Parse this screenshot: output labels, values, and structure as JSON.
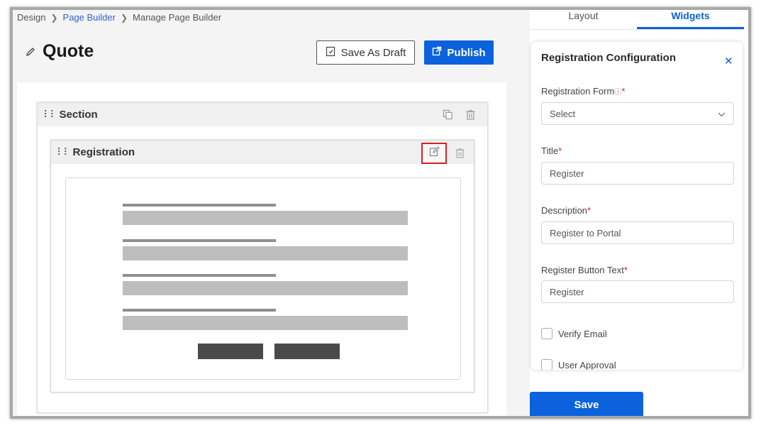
{
  "breadcrumb": {
    "items": [
      "Design",
      "Page Builder",
      "Manage Page Builder"
    ]
  },
  "page": {
    "title": "Quote"
  },
  "toolbar": {
    "save_draft_label": "Save As Draft",
    "publish_label": "Publish"
  },
  "section": {
    "title": "Section"
  },
  "widget": {
    "title": "Registration"
  },
  "panel": {
    "tabs": [
      {
        "label": "Layout",
        "active": false
      },
      {
        "label": "Widgets",
        "active": true
      }
    ],
    "config": {
      "title": "Registration Configuration",
      "registration_form": {
        "label": "Registration Form",
        "required_mark": "*",
        "value": "Select"
      },
      "title_field": {
        "label": "Title",
        "required_mark": "*",
        "value": "Register"
      },
      "description_field": {
        "label": "Description",
        "required_mark": "*",
        "value": "Register to Portal"
      },
      "button_text_field": {
        "label": "Register Button Text",
        "required_mark": "*",
        "value": "Register"
      },
      "verify_email": {
        "label": "Verify Email",
        "checked": false
      },
      "user_approval": {
        "label": "User Approval",
        "checked": false
      }
    },
    "save_label": "Save"
  },
  "colors": {
    "accent": "#0b62dc",
    "highlight": "#d62020",
    "required": "#d62020"
  }
}
